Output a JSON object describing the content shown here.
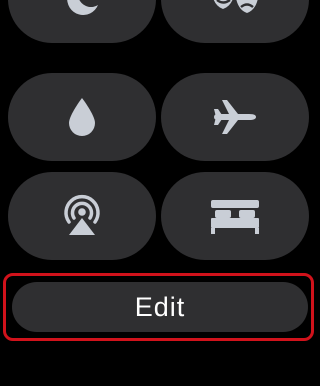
{
  "controls": [
    {
      "id": "moon",
      "icon": "moon-icon"
    },
    {
      "id": "theater",
      "icon": "theater-masks-icon"
    },
    {
      "id": "water-lock",
      "icon": "water-drop-icon"
    },
    {
      "id": "airplane-mode",
      "icon": "airplane-icon"
    },
    {
      "id": "airplay",
      "icon": "airplay-icon"
    },
    {
      "id": "sleep",
      "icon": "bed-icon"
    }
  ],
  "edit": {
    "label": "Edit"
  },
  "colors": {
    "background": "#000000",
    "tile": "#2f2f31",
    "icon": "#c9ced6",
    "highlight": "#d1121b",
    "text": "#ffffff"
  }
}
